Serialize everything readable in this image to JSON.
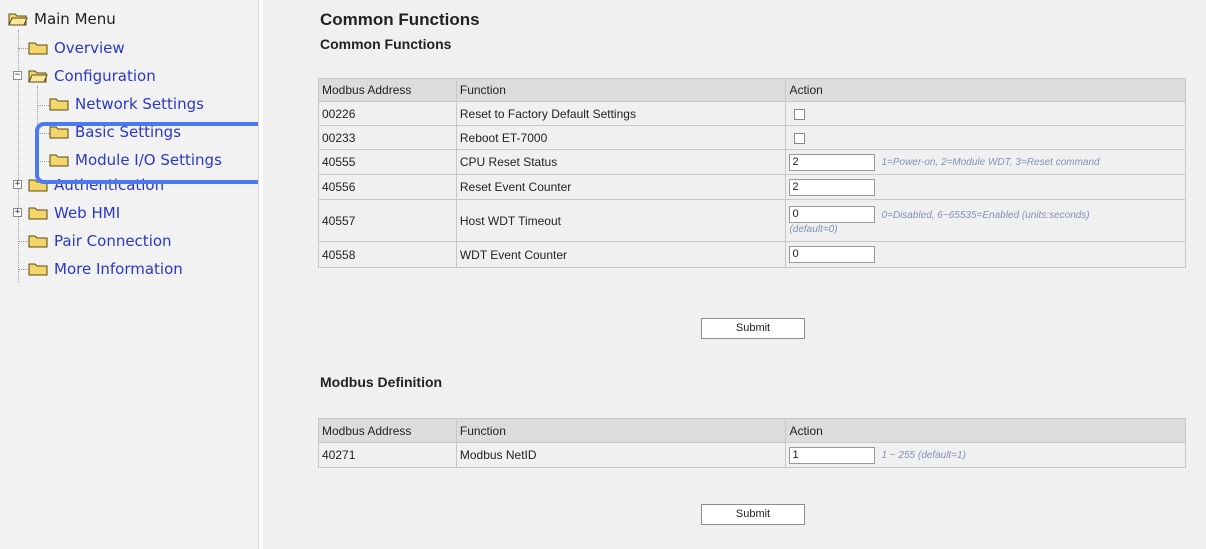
{
  "sidebar": {
    "root_label": "Main Menu",
    "items": [
      {
        "label": "Overview"
      },
      {
        "label": "Configuration"
      },
      {
        "label": "Network Settings"
      },
      {
        "label": "Basic Settings"
      },
      {
        "label": "Module I/O Settings"
      },
      {
        "label": "Authentication"
      },
      {
        "label": "Web HMI"
      },
      {
        "label": "Pair Connection"
      },
      {
        "label": "More Information"
      }
    ]
  },
  "main": {
    "title": "Common Functions",
    "subtitle": "Common Functions",
    "common_table": {
      "headers": [
        "Modbus Address",
        "Function",
        "Action"
      ],
      "rows": [
        {
          "address": "00226",
          "function": "Reset to Factory Default Settings"
        },
        {
          "address": "00233",
          "function": "Reboot ET-7000"
        },
        {
          "address": "40555",
          "function": "CPU Reset Status",
          "value": "2",
          "hint": "1=Power-on, 2=Module WDT, 3=Reset command"
        },
        {
          "address": "40556",
          "function": "Reset Event Counter",
          "value": "2"
        },
        {
          "address": "40557",
          "function": "Host WDT Timeout",
          "value": "0",
          "hint": "0=Disabled, 6~65535=Enabled (units:seconds)",
          "hint2": "(default=0)"
        },
        {
          "address": "40558",
          "function": "WDT Event Counter",
          "value": "0"
        }
      ]
    },
    "submit_label": "Submit",
    "modbus_title": "Modbus Definition",
    "modbus_table": {
      "headers": [
        "Modbus Address",
        "Function",
        "Action"
      ],
      "rows": [
        {
          "address": "40271",
          "function": "Modbus NetID",
          "value": "1",
          "hint": "1 ~ 255 (default=1)"
        }
      ]
    },
    "submit_label_2": "Submit"
  }
}
